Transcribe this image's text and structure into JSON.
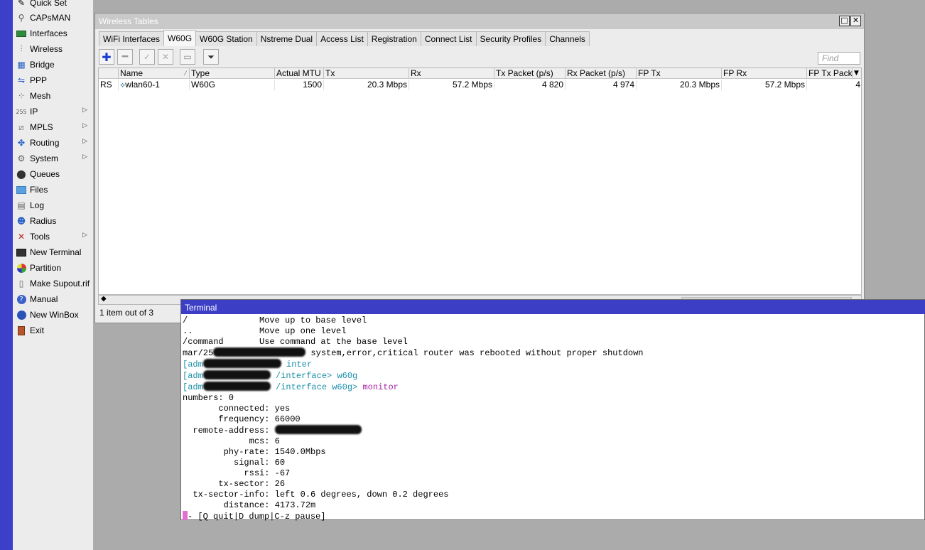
{
  "sidebar": {
    "items": [
      {
        "label": "Quick Set",
        "icon": "quick-set-icon"
      },
      {
        "label": "CAPsMAN",
        "icon": "capsman-icon"
      },
      {
        "label": "Interfaces",
        "icon": "interfaces-icon"
      },
      {
        "label": "Wireless",
        "icon": "wireless-icon"
      },
      {
        "label": "Bridge",
        "icon": "bridge-icon"
      },
      {
        "label": "PPP",
        "icon": "ppp-icon"
      },
      {
        "label": "Mesh",
        "icon": "mesh-icon"
      },
      {
        "label": "IP",
        "icon": "ip-icon"
      },
      {
        "label": "MPLS",
        "icon": "mpls-icon"
      },
      {
        "label": "Routing",
        "icon": "routing-icon"
      },
      {
        "label": "System",
        "icon": "system-icon"
      },
      {
        "label": "Queues",
        "icon": "queues-icon"
      },
      {
        "label": "Files",
        "icon": "files-icon"
      },
      {
        "label": "Log",
        "icon": "log-icon"
      },
      {
        "label": "Radius",
        "icon": "radius-icon"
      },
      {
        "label": "Tools",
        "icon": "tools-icon"
      },
      {
        "label": "New Terminal",
        "icon": "terminal-icon"
      },
      {
        "label": "Partition",
        "icon": "partition-icon"
      },
      {
        "label": "Make Supout.rif",
        "icon": "supout-icon"
      },
      {
        "label": "Manual",
        "icon": "manual-icon"
      },
      {
        "label": "New WinBox",
        "icon": "winbox-icon"
      },
      {
        "label": "Exit",
        "icon": "exit-icon"
      }
    ]
  },
  "window": {
    "title": "Wireless Tables",
    "tabs": [
      "WiFi Interfaces",
      "W60G",
      "W60G Station",
      "Nstreme Dual",
      "Access List",
      "Registration",
      "Connect List",
      "Security Profiles",
      "Channels"
    ],
    "active_tab": "W60G",
    "find_placeholder": "Find",
    "columns": [
      "Name",
      "Type",
      "Actual MTU",
      "Tx",
      "Rx",
      "Tx Packet (p/s)",
      "Rx Packet (p/s)",
      "FP Tx",
      "FP Rx",
      "FP Tx Pack"
    ],
    "rows": [
      {
        "flags": "RS",
        "name": "wlan60-1",
        "type": "W60G",
        "mtu": "1500",
        "tx": "20.3 Mbps",
        "rx": "57.2 Mbps",
        "tx_packet": "4 820",
        "rx_packet": "4 974",
        "fp_tx": "20.3 Mbps",
        "fp_rx": "57.2 Mbps",
        "fp_tx_pack": "4"
      }
    ],
    "status": "1 item out of 3"
  },
  "terminal": {
    "title": "Terminal",
    "help_lines": [
      "/              Move up to base level",
      "..             Move up one level",
      "/command       Use command at the base level"
    ],
    "log_prefix": "mar/25",
    "log_text": "system,error,critical router was rebooted without proper shutdown",
    "prompt_prefix": "[adm",
    "cmd1_path": "inter",
    "cmd2_path": "/interface>",
    "cmd2_cmd": "w60g",
    "cmd3_path": "/interface w60g>",
    "cmd3_cmd": "monitor",
    "numbers_line": "numbers: 0",
    "monitor": [
      {
        "key": "       connected:",
        "value": "yes"
      },
      {
        "key": "       frequency:",
        "value": "66000"
      },
      {
        "key": "  remote-address:",
        "value": ""
      },
      {
        "key": "             mcs:",
        "value": "6"
      },
      {
        "key": "        phy-rate:",
        "value": "1540.0Mbps"
      },
      {
        "key": "          signal:",
        "value": "60"
      },
      {
        "key": "            rssi:",
        "value": "-67"
      },
      {
        "key": "       tx-sector:",
        "value": "26"
      },
      {
        "key": "  tx-sector-info:",
        "value": "left 0.6 degrees, down 0.2 degrees"
      },
      {
        "key": "        distance:",
        "value": "4173.72m"
      }
    ],
    "footer": "- [Q quit|D dump|C-z pause]"
  },
  "colors": {
    "accent_blue": "#3c3fc6",
    "cyan_text": "#1a8fa8",
    "magenta_text": "#a51ea5"
  }
}
